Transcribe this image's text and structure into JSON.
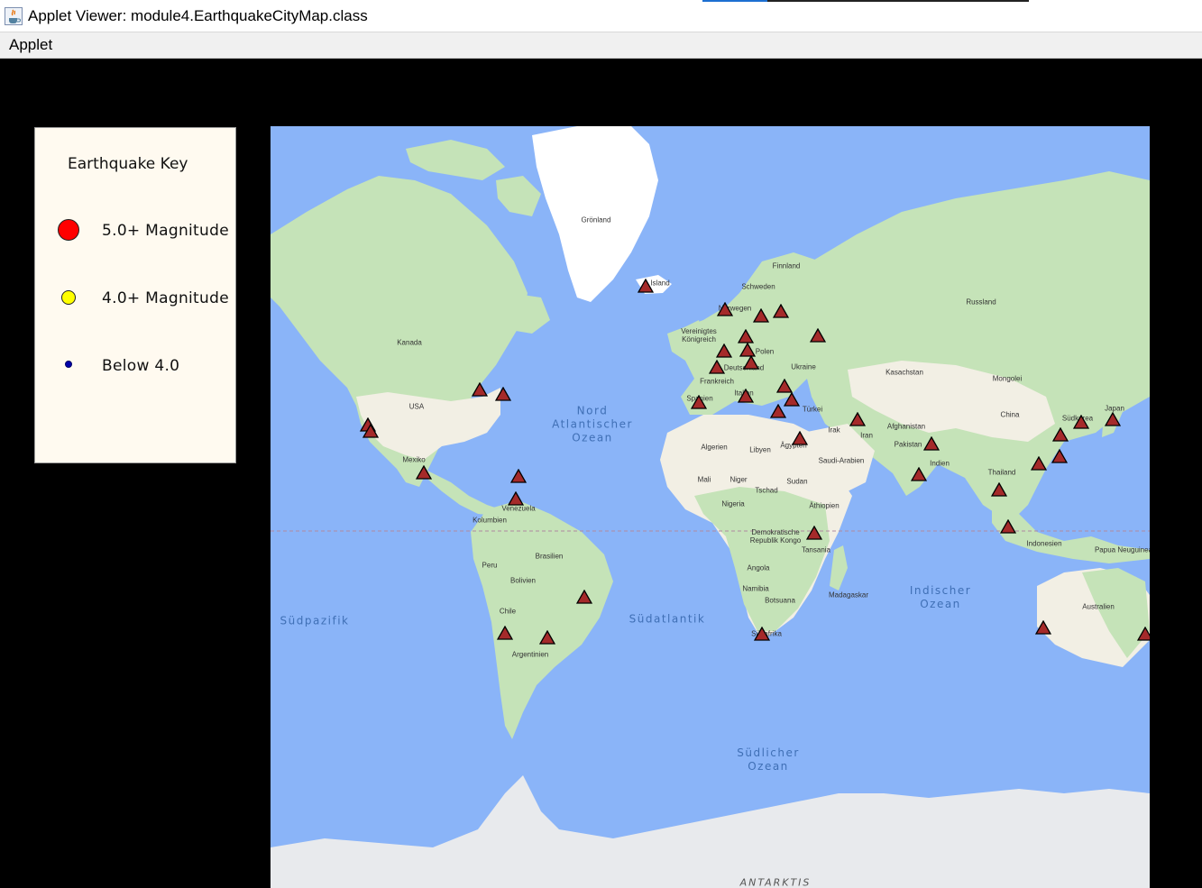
{
  "window": {
    "title": "Applet Viewer: module4.EarthquakeCityMap.class",
    "icon": "java-cup-icon"
  },
  "menu": {
    "items": [
      "Applet"
    ]
  },
  "key": {
    "title": "Earthquake Key",
    "items": [
      {
        "label": "5.0+ Magnitude",
        "color": "#ff0000"
      },
      {
        "label": "4.0+ Magnitude",
        "color": "#ffff00"
      },
      {
        "label": "Below 4.0",
        "color": "#0000ff"
      }
    ]
  },
  "map": {
    "water_color": "#8ab4f8",
    "land_color": "#c5e3b8",
    "desert_color": "#f1efe6",
    "ice_color": "#ffffff",
    "marker_color": "#a52a2a",
    "labels": {
      "greenland": "Grönland",
      "iceland": "Island",
      "finland": "Finnland",
      "sweden": "Schweden",
      "norway": "Norwegen",
      "russia": "Russland",
      "uk": "Vereinigtes Königreich",
      "poland": "Polen",
      "germany": "Deutschland",
      "ukraine": "Ukraine",
      "france": "Frankreich",
      "kazakhstan": "Kasachstan",
      "mongolia": "Mongolei",
      "canada": "Kanada",
      "usa": "USA",
      "spain": "Spanien",
      "italy": "Italien",
      "turkey": "Türkei",
      "iraq": "Irak",
      "iran": "Iran",
      "afghanistan": "Afghanistan",
      "china": "China",
      "japan": "Japan",
      "south_korea": "Südkorea",
      "pakistan": "Pakistan",
      "algeria": "Algerien",
      "libya": "Libyen",
      "egypt": "Ägypten",
      "saudi": "Saudi-Arabien",
      "india": "Indien",
      "thailand": "Thailand",
      "mexico": "Mexiko",
      "mali": "Mali",
      "niger": "Niger",
      "chad": "Tschad",
      "sudan": "Sudan",
      "ethiopia": "Äthiopien",
      "nigeria": "Nigeria",
      "venezuela": "Venezuela",
      "colombia": "Kolumbien",
      "drc": "Demokratische Republik Kongo",
      "tanzania": "Tansania",
      "indonesia": "Indonesien",
      "png": "Papua Neuguinea",
      "brazil": "Brasilien",
      "peru": "Peru",
      "bolivia": "Bolivien",
      "angola": "Angola",
      "namibia": "Namibia",
      "botswana": "Botsuana",
      "madagascar": "Madagaskar",
      "australia": "Australien",
      "chile": "Chile",
      "south_africa": "Südafrika",
      "argentina": "Argentinien"
    },
    "oceans": {
      "north_atlantic": "Nord\nAtlantischer\nOzean",
      "south_pacific": "Südpazifik",
      "south_atlantic": "Südatlantik",
      "indian": "Indischer\nOzean",
      "southern": "Südlicher\nOzean"
    },
    "antarctica": "ANTARKTIS",
    "marker_count": 46
  }
}
